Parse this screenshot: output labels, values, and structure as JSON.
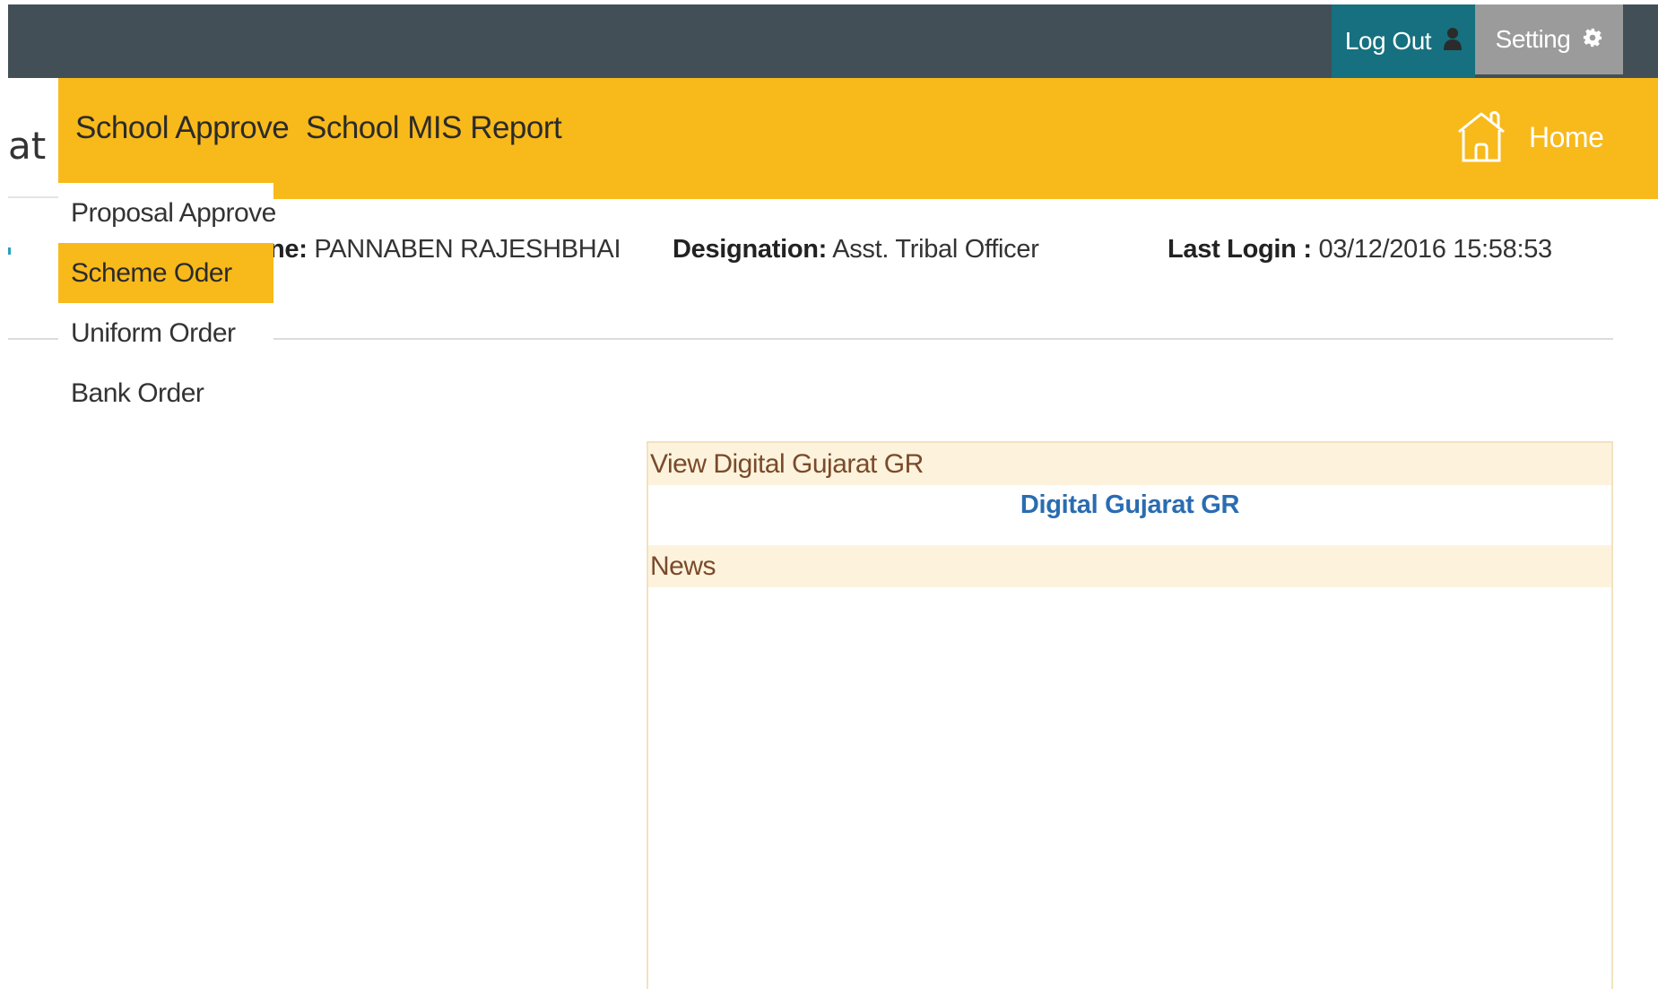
{
  "topbar": {
    "logout_label": "Log Out",
    "setting_label": "Setting",
    "logout_icon": "user-icon",
    "setting_icon": "gear-icon",
    "colors": {
      "bar": "#434f56",
      "logout": "#16707f",
      "setting": "#9b9b9b"
    }
  },
  "brand": {
    "partial_text": "at"
  },
  "nav": {
    "items": [
      {
        "label": "School Approve"
      },
      {
        "label": "School MIS Report"
      }
    ],
    "home_label": "Home",
    "home_icon": "home-icon",
    "color": "#f8b91b"
  },
  "dropdown": {
    "items": [
      {
        "label": "Proposal Approve",
        "active": false
      },
      {
        "label": "Scheme Oder",
        "active": true
      },
      {
        "label": "Uniform Order",
        "active": false
      },
      {
        "label": "Bank Order",
        "active": false
      }
    ]
  },
  "user_info": {
    "name_label_partial": "ne:",
    "name_value": "PANNABEN RAJESHBHAI",
    "designation_label": "Designation:",
    "designation_value": "Asst. Tribal Officer",
    "last_login_label": "Last Login :",
    "last_login_value": "03/12/2016 15:58:53"
  },
  "panel": {
    "gr_heading": "View Digital Gujarat GR",
    "gr_link": "Digital Gujarat GR",
    "news_heading": "News"
  }
}
